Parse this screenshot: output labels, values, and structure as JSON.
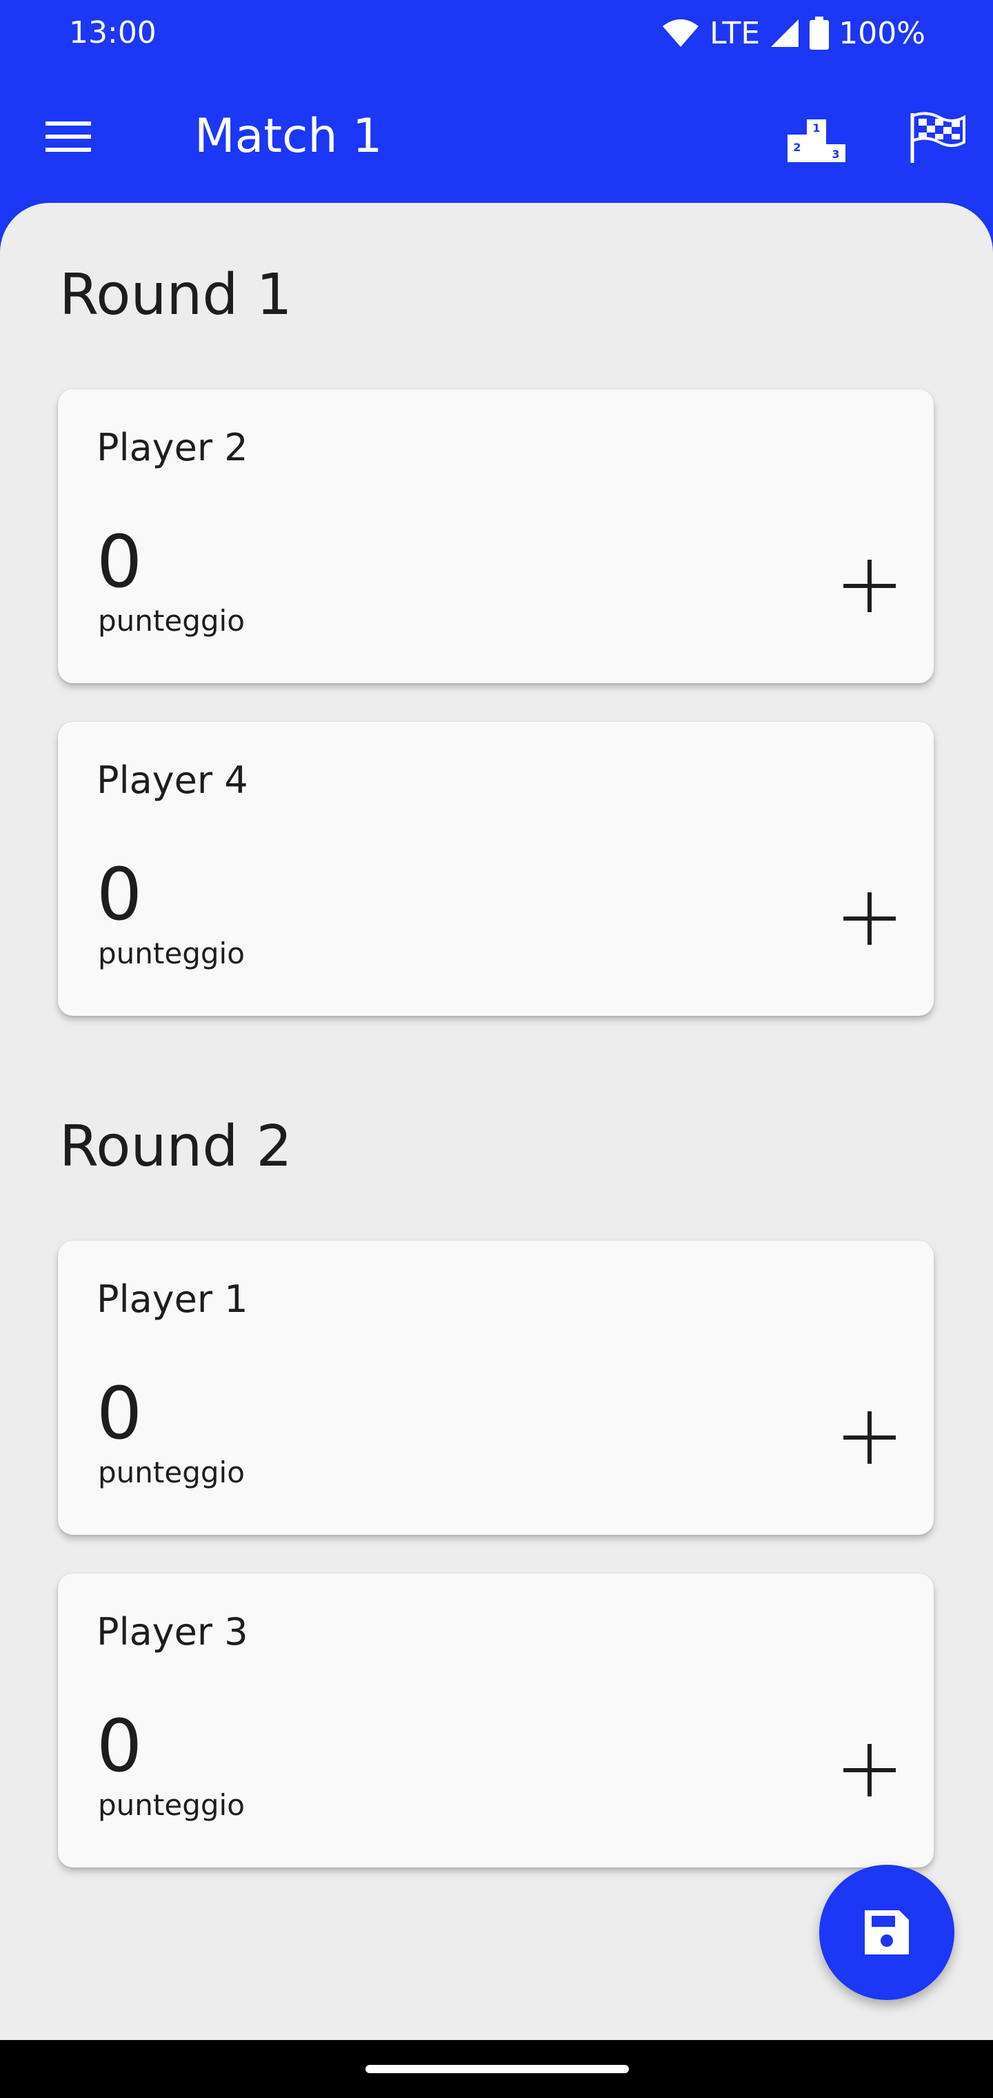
{
  "status_bar": {
    "time": "13:00",
    "network": "LTE",
    "battery": "100%",
    "icons": [
      "wifi-icon",
      "signal-icon",
      "battery-icon"
    ]
  },
  "app_bar": {
    "title": "Match 1",
    "actions": [
      "menu-icon",
      "podium-icon",
      "flag-icon"
    ],
    "podium_numbers": [
      "1",
      "2",
      "3"
    ]
  },
  "rounds": [
    {
      "title": "Round 1",
      "players": [
        {
          "name": "Player 2",
          "score": "0",
          "score_label": "punteggio"
        },
        {
          "name": "Player 4",
          "score": "0",
          "score_label": "punteggio"
        }
      ]
    },
    {
      "title": "Round 2",
      "players": [
        {
          "name": "Player 1",
          "score": "0",
          "score_label": "punteggio"
        },
        {
          "name": "Player 3",
          "score": "0",
          "score_label": "punteggio"
        }
      ]
    }
  ],
  "fab": {
    "icon": "save-icon"
  },
  "colors": {
    "primary": "#1c37f5",
    "background": "#ededed",
    "card": "#f9f9f9",
    "text": "#1d1d1d"
  }
}
